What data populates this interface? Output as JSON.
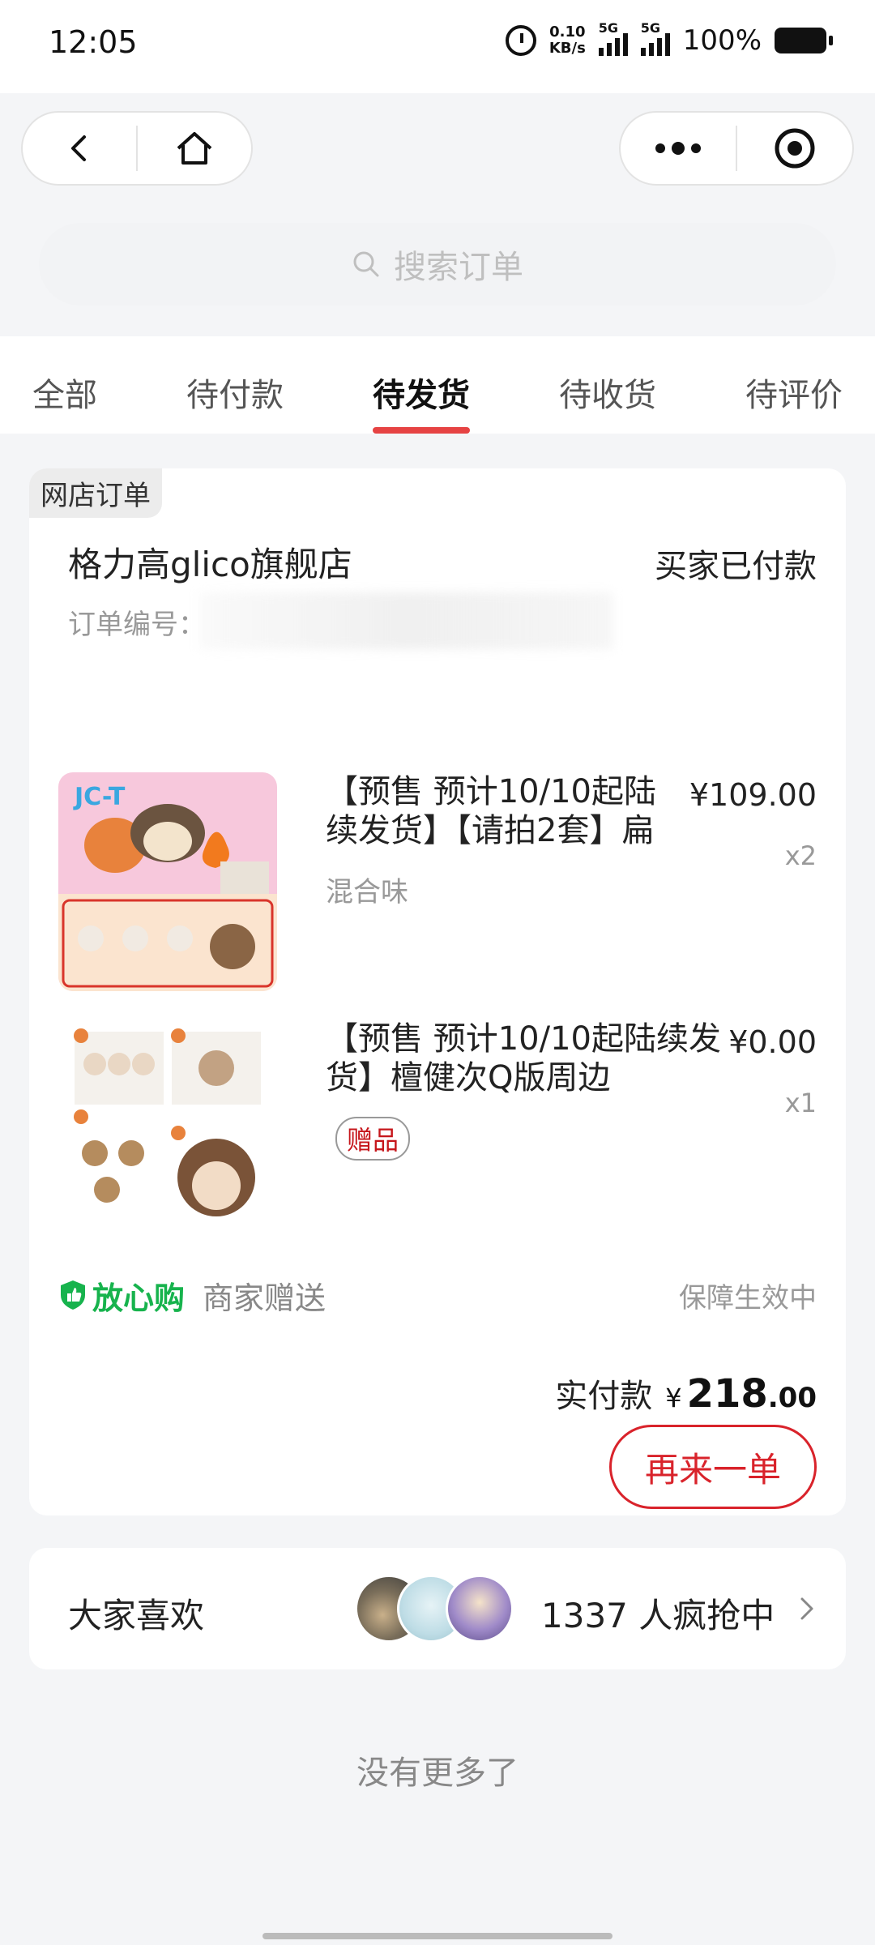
{
  "status_bar": {
    "time": "12:05",
    "net_speed_value": "0.10",
    "net_speed_unit": "KB/s",
    "signal1_label": "5G",
    "signal2_label": "5G",
    "battery": "100%"
  },
  "search": {
    "placeholder": "搜索订单"
  },
  "tabs": [
    "全部",
    "待付款",
    "待发货",
    "待收货",
    "待评价"
  ],
  "active_tab": "待发货",
  "order": {
    "tag": "网店订单",
    "shop_name": "格力高glico旗舰店",
    "status": "买家已付款",
    "order_no_label": "订单编号：",
    "items": [
      {
        "title": "【预售 预计10/10起陆续发货】【请拍2套】扁",
        "spec": "混合味",
        "price": "¥109.00",
        "qty": "x2"
      },
      {
        "title": "【预售 预计10/10起陆续发货】檀健次Q版周边",
        "badge": "赠品",
        "price": "¥0.00",
        "qty": "x1"
      }
    ],
    "guarantee_brand": "放心购",
    "guarantee_sub": "商家赠送",
    "guarantee_status": "保障生效中",
    "paid_label": "实付款",
    "paid_currency": "¥",
    "paid_integer": "218",
    "paid_decimal": ".00",
    "reorder_label": "再来一单"
  },
  "recommend": {
    "title": "大家喜欢",
    "count_text": "1337 人疯抢中"
  },
  "footer": {
    "no_more": "没有更多了"
  },
  "colors": {
    "accent": "#e64343",
    "price_red": "#d9232b",
    "guarantee_green": "#17b34d"
  }
}
